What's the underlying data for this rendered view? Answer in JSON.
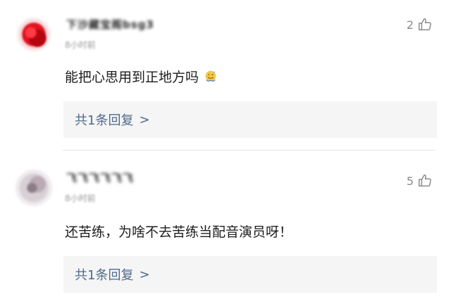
{
  "comments": [
    {
      "username": "下沙藏宝阁bsg3",
      "time": "8小时前",
      "likes": "2",
      "text": "能把心思用到正地方吗",
      "emoji": "sweat-smile-icon",
      "reply_label": "共1条回复",
      "reply_arrow": ">"
    },
    {
      "username": "飞飞飞飞飞飞",
      "time": "8小时前",
      "likes": "5",
      "text": "还苦练，为啥不去苦练当配音演员呀！",
      "reply_label": "共1条回复",
      "reply_arrow": ">"
    }
  ],
  "colors": {
    "reply_link": "#4e6a8e",
    "reply_bg": "#f5f5f5",
    "meta_gray": "#9a9a9a"
  }
}
